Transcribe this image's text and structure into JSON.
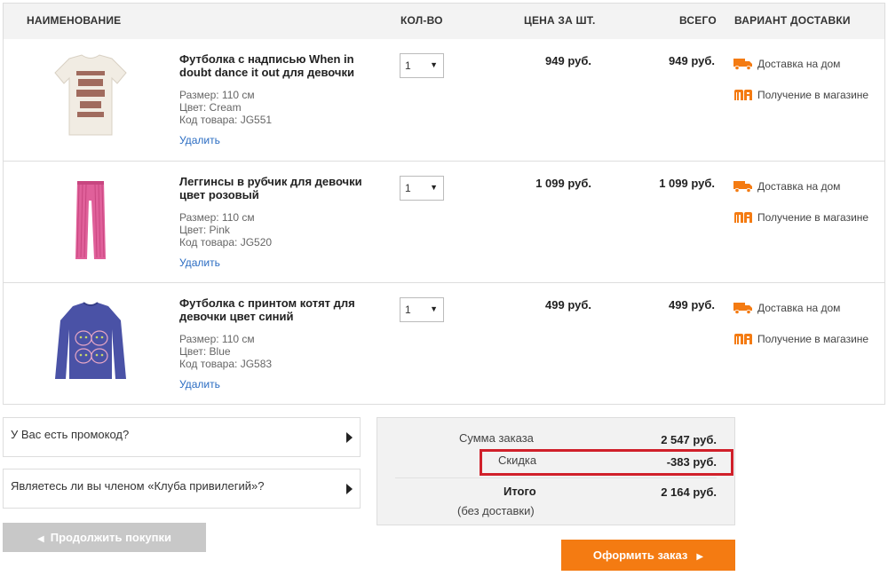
{
  "header": {
    "name": "НАИМЕНОВАНИЕ",
    "qty": "КОЛ-ВО",
    "price": "ЦЕНА ЗА ШТ.",
    "total": "ВСЕГО",
    "delivery": "ВАРИАНТ ДОСТАВКИ"
  },
  "items": [
    {
      "title": "Футболка с надписью When in doubt dance it out для девочки",
      "size": "Размер:  110 см",
      "color": "Цвет: Cream",
      "code": "Код товара: JG551",
      "remove": "Удалить",
      "qty": "1",
      "price": "949 руб.",
      "total": "949 руб.",
      "image": "cream-tshirt-image"
    },
    {
      "title": "Леггинсы в рубчик для девочки цвет розовый",
      "size": "Размер:  110 см",
      "color": "Цвет: Pink",
      "code": "Код товара: JG520",
      "remove": "Удалить",
      "qty": "1",
      "price": "1 099 руб.",
      "total": "1 099 руб.",
      "image": "pink-leggings-image"
    },
    {
      "title": "Футболка с принтом котят для девочки цвет синий",
      "size": "Размер:  110 см",
      "color": "Цвет: Blue",
      "code": "Код товара: JG583",
      "remove": "Удалить",
      "qty": "1",
      "price": "499 руб.",
      "total": "499 руб.",
      "image": "blue-longsleeve-image"
    }
  ],
  "delivery_options": {
    "home": "Доставка на дом",
    "store": "Получение в магазине",
    "home_icon": "truck-icon",
    "store_icon": "store-logo-icon"
  },
  "panels": {
    "promo": "У Вас есть промокод?",
    "club": "Являетесь ли вы членом «Клуба привилегий»?"
  },
  "summary": {
    "sum_label": "Сумма заказа",
    "sum_value": "2 547 руб.",
    "discount_label": "Скидка",
    "discount_value": "-383 руб.",
    "total_label": "Итого",
    "total_value": "2 164 руб.",
    "note": "(без доставки)"
  },
  "buttons": {
    "continue": "Продолжить покупки",
    "checkout": "Оформить заказ"
  },
  "colors": {
    "accent": "#f47b12",
    "highlight": "#d0202a",
    "link": "#2a6cc2"
  }
}
